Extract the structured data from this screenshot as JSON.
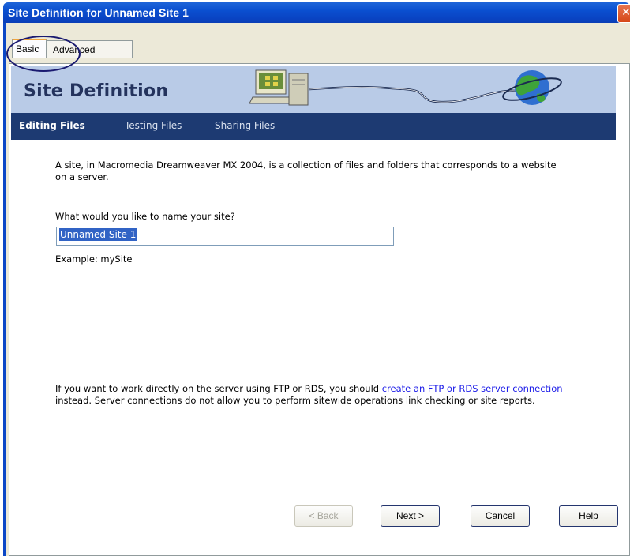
{
  "window": {
    "title": "Site Definition for Unnamed Site 1",
    "close_glyph": "✕"
  },
  "tabs": [
    {
      "label": "Basic",
      "active": true
    },
    {
      "label": "Advanced",
      "active": false
    }
  ],
  "banner": {
    "title": "Site Definition"
  },
  "nav": [
    {
      "label": "Editing Files",
      "active": true
    },
    {
      "label": "Testing Files",
      "active": false
    },
    {
      "label": "Sharing Files",
      "active": false
    }
  ],
  "content": {
    "intro": "A site, in Macromedia Dreamweaver MX 2004, is a collection of files and folders that corresponds to a website on a server.",
    "question": "What would you like to name your site?",
    "site_name_value": "Unnamed Site 1",
    "example": "Example: mySite",
    "server_text_before": "If you want to work directly on the server using FTP or RDS, you should ",
    "server_link": "create an FTP or RDS server connection",
    "server_text_after": " instead. Server connections do not allow you to perform sitewide operations link checking or site reports."
  },
  "buttons": {
    "back": "< Back",
    "next": "Next >",
    "cancel": "Cancel",
    "help": "Help"
  },
  "colors": {
    "titlebar": "#0a4fd0",
    "banner": "#b9cbe7",
    "navbar": "#1d3a72",
    "link": "#1a1ae8",
    "selection": "#3163c5"
  }
}
